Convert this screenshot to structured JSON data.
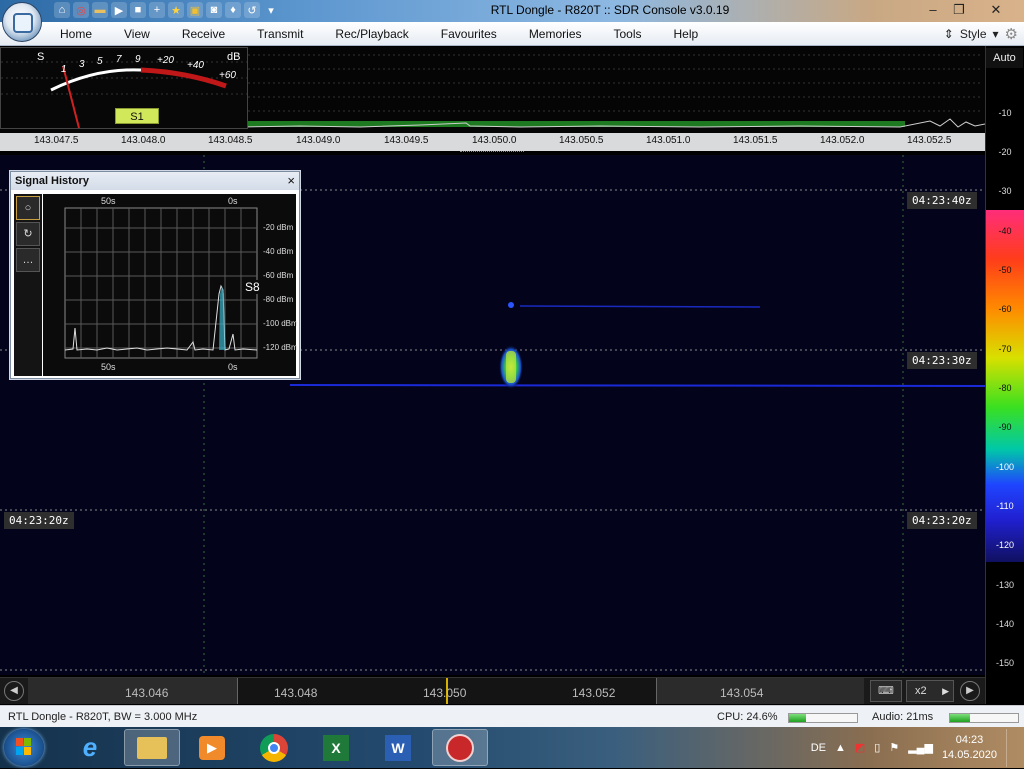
{
  "window": {
    "title": "RTL Dongle - R820T :: SDR Console v3.0.19"
  },
  "menu": [
    "Home",
    "View",
    "Receive",
    "Transmit",
    "Rec/Playback",
    "Favourites",
    "Memories",
    "Tools",
    "Help"
  ],
  "style_label": "Style",
  "smeter": {
    "scale_low": [
      "S",
      "1",
      "3",
      "5",
      "7",
      "9"
    ],
    "scale_high": [
      "+20",
      "+40",
      "+60"
    ],
    "unit": "dB",
    "reading": "S1"
  },
  "freq_ticks": [
    "143.047.5",
    "143.048.0",
    "143.048.5",
    "143.049.0",
    "143.049.5",
    "143.050.0",
    "143.050.5",
    "143.051.0",
    "143.051.5",
    "143.052.0",
    "143.052.5"
  ],
  "db_scale": {
    "auto": "Auto",
    "top_labels": [
      "-10",
      "-20",
      "-30"
    ],
    "color_labels": [
      "-40",
      "-50",
      "-60",
      "-70",
      "-80",
      "-90",
      "-100",
      "-110",
      "-120"
    ],
    "bottom_labels": [
      "-130",
      "-140",
      "-150"
    ]
  },
  "timestamps": {
    "t1": "04:23:40z",
    "t2": "04:23:30z",
    "t3": "04:23:20z",
    "t3_left": "04:23:20z"
  },
  "signal_history": {
    "title": "Signal History",
    "close": "×",
    "top_time_left": "50s",
    "top_time_right": "0s",
    "bottom_time_left": "50s",
    "bottom_time_right": "0s",
    "levels": [
      "-20 dBm",
      "-40 dBm",
      "-60 dBm",
      "-80 dBm",
      "-100 dBm",
      "-120 dBm"
    ],
    "s_reading": "S8"
  },
  "bottom_scale": {
    "ticks": [
      "143.046",
      "143.048",
      "143.050",
      "143.052",
      "143.054"
    ],
    "zoom": "x2"
  },
  "status": {
    "device": "RTL Dongle - R820T, BW = 3.000 MHz",
    "cpu": "CPU: 24.6%",
    "cpu_fill": 0.246,
    "audio": "Audio: 21ms",
    "audio_fill": 0.3
  },
  "taskbar": {
    "lang": "DE",
    "time": "04:23",
    "date": "14.05.2020"
  },
  "colors": {
    "accent": "#d0e85a",
    "waterfall_bg": "#03041c",
    "ribbon": "#e6ecf3"
  }
}
